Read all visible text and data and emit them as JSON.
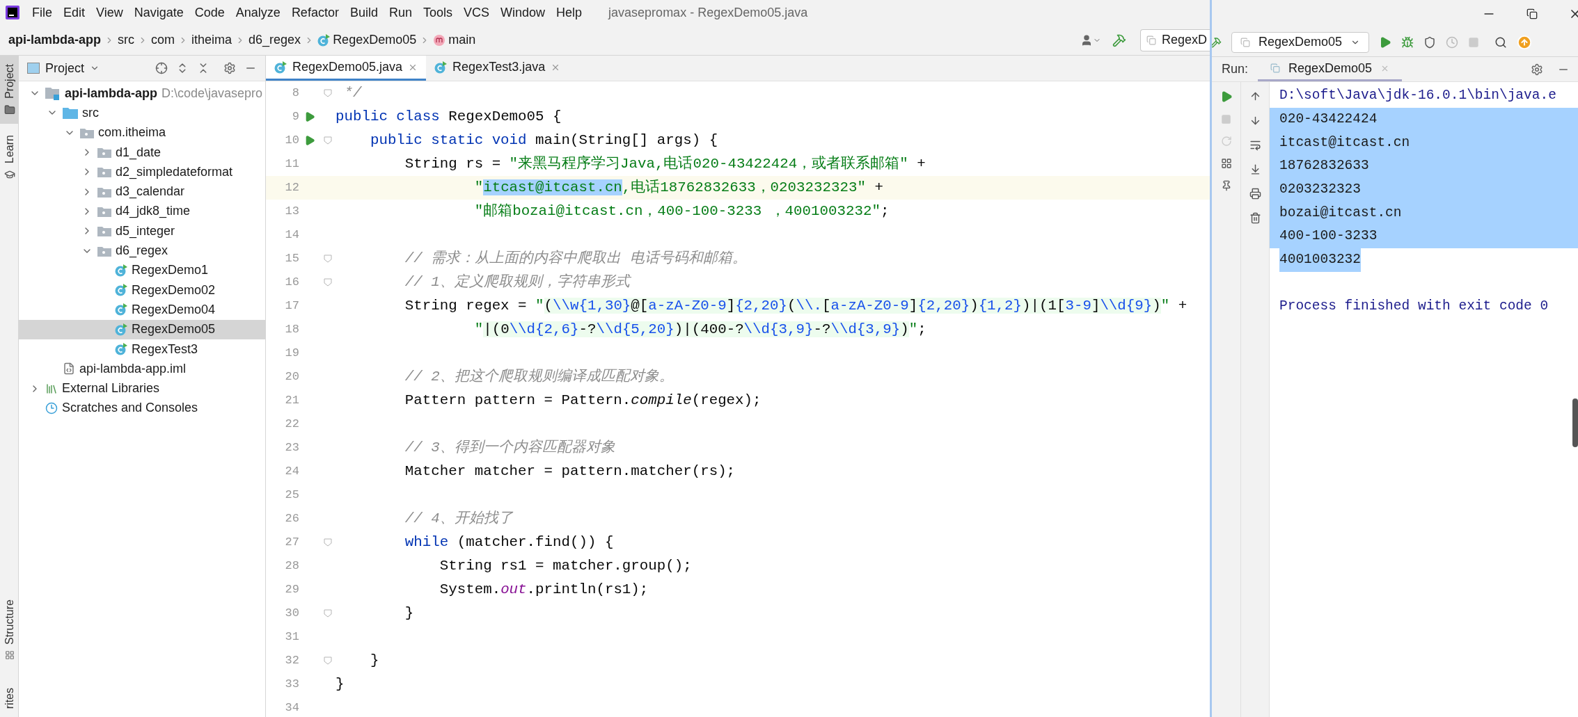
{
  "window": {
    "title": "javasepromax - RegexDemo05.java"
  },
  "menu": [
    "File",
    "Edit",
    "View",
    "Navigate",
    "Code",
    "Analyze",
    "Refactor",
    "Build",
    "Run",
    "Tools",
    "VCS",
    "Window",
    "Help"
  ],
  "breadcrumbs": [
    {
      "label": "api-lambda-app",
      "kind": "module"
    },
    {
      "label": "src",
      "kind": "folder"
    },
    {
      "label": "com",
      "kind": "folder"
    },
    {
      "label": "itheima",
      "kind": "folder"
    },
    {
      "label": "d6_regex",
      "kind": "folder"
    },
    {
      "label": "RegexDemo05",
      "kind": "class"
    },
    {
      "label": "main",
      "kind": "method"
    }
  ],
  "toolbar": {
    "cut_config": "RegexD",
    "run_config": "RegexDemo05"
  },
  "side_stripe": [
    {
      "label": "Project",
      "selected": true,
      "kind": "folder"
    },
    {
      "label": "Learn",
      "selected": false,
      "kind": "cap"
    }
  ],
  "side_stripe_bottom": [
    {
      "label": "Structure",
      "kind": "structure"
    },
    {
      "label": "rites",
      "kind": "none"
    }
  ],
  "project": {
    "title": "Project",
    "tree": [
      {
        "label": "api-lambda-app",
        "kind": "module",
        "hint": "D:\\code\\javasepro",
        "expanded": true,
        "selected": false,
        "children": [
          {
            "label": "src",
            "kind": "source",
            "expanded": true,
            "selected": false,
            "children": [
              {
                "label": "com.itheima",
                "kind": "package",
                "expanded": true,
                "selected": false,
                "children": [
                  {
                    "label": "d1_date",
                    "kind": "package",
                    "expanded": false,
                    "selected": false
                  },
                  {
                    "label": "d2_simpledateformat",
                    "kind": "package",
                    "expanded": false,
                    "selected": false
                  },
                  {
                    "label": "d3_calendar",
                    "kind": "package",
                    "expanded": false,
                    "selected": false
                  },
                  {
                    "label": "d4_jdk8_time",
                    "kind": "package",
                    "expanded": false,
                    "selected": false
                  },
                  {
                    "label": "d5_integer",
                    "kind": "package",
                    "expanded": false,
                    "selected": false
                  },
                  {
                    "label": "d6_regex",
                    "kind": "package",
                    "expanded": true,
                    "selected": false,
                    "children": [
                      {
                        "label": "RegexDemo1",
                        "kind": "class",
                        "selected": false
                      },
                      {
                        "label": "RegexDemo02",
                        "kind": "class",
                        "selected": false
                      },
                      {
                        "label": "RegexDemo04",
                        "kind": "class",
                        "selected": false
                      },
                      {
                        "label": "RegexDemo05",
                        "kind": "class",
                        "selected": true
                      },
                      {
                        "label": "RegexTest3",
                        "kind": "class",
                        "selected": false
                      }
                    ]
                  }
                ]
              }
            ]
          },
          {
            "label": "api-lambda-app.iml",
            "kind": "iml",
            "selected": false
          }
        ]
      },
      {
        "label": "External Libraries",
        "kind": "libraries",
        "expanded": false,
        "selected": false
      },
      {
        "label": "Scratches and Consoles",
        "kind": "scratches",
        "selected": false
      }
    ]
  },
  "editor_tabs": [
    {
      "label": "RegexDemo05.java",
      "selected": true
    },
    {
      "label": "RegexTest3.java",
      "selected": false
    }
  ],
  "lines": [
    {
      "number": "8",
      "run": false,
      "fold": true,
      "current": false,
      "tokens": [
        {
          "text": " */",
          "kind": "comment"
        }
      ]
    },
    {
      "number": "9",
      "run": true,
      "fold": false,
      "current": false,
      "tokens": [
        {
          "text": "public class",
          "kind": "keyword"
        },
        {
          "text": " RegexDemo05 {",
          "kind": "plain"
        }
      ]
    },
    {
      "number": "10",
      "run": true,
      "fold": true,
      "current": false,
      "tokens": [
        {
          "text": "    public static void",
          "kind": "keyword"
        },
        {
          "text": " main(String[] args) {",
          "kind": "plain"
        }
      ]
    },
    {
      "number": "11",
      "run": false,
      "fold": false,
      "current": false,
      "tokens": [
        {
          "text": "        String rs = ",
          "kind": "plain"
        },
        {
          "text": "\"来黑马程序学习Java,电话020-43422424，或者联系邮箱\"",
          "kind": "string"
        },
        {
          "text": " +",
          "kind": "plain"
        }
      ]
    },
    {
      "number": "12",
      "run": false,
      "fold": false,
      "current": true,
      "tokens": [
        {
          "text": "                \"",
          "kind": "string"
        },
        {
          "text": "itcast@itcast.cn",
          "kind": "selection"
        },
        {
          "text": ",电话18762832633，0203232323\"",
          "kind": "string"
        },
        {
          "text": " +",
          "kind": "plain"
        }
      ]
    },
    {
      "number": "13",
      "run": false,
      "fold": false,
      "current": false,
      "tokens": [
        {
          "text": "                \"邮箱bozai@itcast.cn，400-100-3233 ，4001003232\"",
          "kind": "string"
        },
        {
          "text": ";",
          "kind": "plain"
        }
      ]
    },
    {
      "number": "14",
      "run": false,
      "fold": false,
      "current": false
    },
    {
      "number": "15",
      "run": false,
      "fold": true,
      "current": false,
      "tokens": [
        {
          "text": "        // 需求：从上面的内容中爬取出 电话号码和邮箱。",
          "kind": "comment"
        }
      ]
    },
    {
      "number": "16",
      "run": false,
      "fold": true,
      "current": false,
      "tokens": [
        {
          "text": "        // 1、定义爬取规则，字符串形式",
          "kind": "comment"
        }
      ]
    },
    {
      "number": "17",
      "run": false,
      "fold": false,
      "current": false,
      "tokens": [
        {
          "text": "        String regex = ",
          "kind": "plain"
        },
        {
          "text": "\"",
          "kind": "string"
        },
        {
          "text": "(",
          "kind": "regex"
        },
        {
          "text": "\\\\w{1,30}",
          "kind": "regex_meta"
        },
        {
          "text": "@[",
          "kind": "regex"
        },
        {
          "text": "a-zA-Z0-9",
          "kind": "regex_meta"
        },
        {
          "text": "]",
          "kind": "regex"
        },
        {
          "text": "{2,20}",
          "kind": "regex_meta"
        },
        {
          "text": "(",
          "kind": "regex"
        },
        {
          "text": "\\\\.",
          "kind": "regex_meta"
        },
        {
          "text": "[",
          "kind": "regex"
        },
        {
          "text": "a-zA-Z0-9",
          "kind": "regex_meta"
        },
        {
          "text": "]",
          "kind": "regex"
        },
        {
          "text": "{2,20}",
          "kind": "regex_meta"
        },
        {
          "text": ")",
          "kind": "regex"
        },
        {
          "text": "{1,2}",
          "kind": "regex_meta"
        },
        {
          "text": ")|(1[",
          "kind": "regex"
        },
        {
          "text": "3-9",
          "kind": "regex_meta"
        },
        {
          "text": "]",
          "kind": "regex"
        },
        {
          "text": "\\\\d{9}",
          "kind": "regex_meta"
        },
        {
          "text": ")",
          "kind": "regex"
        },
        {
          "text": "\"",
          "kind": "string"
        },
        {
          "text": " +",
          "kind": "plain"
        }
      ]
    },
    {
      "number": "18",
      "run": false,
      "fold": false,
      "current": false,
      "tokens": [
        {
          "text": "                \"",
          "kind": "string"
        },
        {
          "text": "|(0",
          "kind": "regex"
        },
        {
          "text": "\\\\d{2,6}",
          "kind": "regex_meta"
        },
        {
          "text": "-?",
          "kind": "regex"
        },
        {
          "text": "\\\\d{5,20}",
          "kind": "regex_meta"
        },
        {
          "text": ")|(400-?",
          "kind": "regex"
        },
        {
          "text": "\\\\d{3,9}",
          "kind": "regex_meta"
        },
        {
          "text": "-?",
          "kind": "regex"
        },
        {
          "text": "\\\\d{3,9}",
          "kind": "regex_meta"
        },
        {
          "text": ")",
          "kind": "regex"
        },
        {
          "text": "\"",
          "kind": "string"
        },
        {
          "text": ";",
          "kind": "plain"
        }
      ]
    },
    {
      "number": "19",
      "run": false,
      "fold": false,
      "current": false
    },
    {
      "number": "20",
      "run": false,
      "fold": false,
      "current": false,
      "tokens": [
        {
          "text": "        // 2、把这个爬取规则编译成匹配对象。",
          "kind": "comment"
        }
      ]
    },
    {
      "number": "21",
      "run": false,
      "fold": false,
      "current": false,
      "tokens": [
        {
          "text": "        Pattern pattern = Pattern.",
          "kind": "plain"
        },
        {
          "text": "compile",
          "kind": "static"
        },
        {
          "text": "(regex);",
          "kind": "plain"
        }
      ]
    },
    {
      "number": "22",
      "run": false,
      "fold": false,
      "current": false
    },
    {
      "number": "23",
      "run": false,
      "fold": false,
      "current": false,
      "tokens": [
        {
          "text": "        // 3、得到一个内容匹配器对象",
          "kind": "comment"
        }
      ]
    },
    {
      "number": "24",
      "run": false,
      "fold": false,
      "current": false,
      "tokens": [
        {
          "text": "        Matcher matcher = pattern.matcher(rs);",
          "kind": "plain"
        }
      ]
    },
    {
      "number": "25",
      "run": false,
      "fold": false,
      "current": false
    },
    {
      "number": "26",
      "run": false,
      "fold": false,
      "current": false,
      "tokens": [
        {
          "text": "        // 4、开始找了",
          "kind": "comment"
        }
      ]
    },
    {
      "number": "27",
      "run": false,
      "fold": true,
      "current": false,
      "tokens": [
        {
          "text": "        while",
          "kind": "keyword"
        },
        {
          "text": " (matcher.find()) {",
          "kind": "plain"
        }
      ]
    },
    {
      "number": "28",
      "run": false,
      "fold": false,
      "current": false,
      "tokens": [
        {
          "text": "            String rs1 = matcher.group();",
          "kind": "plain"
        }
      ]
    },
    {
      "number": "29",
      "run": false,
      "fold": false,
      "current": false,
      "tokens": [
        {
          "text": "            System.",
          "kind": "plain"
        },
        {
          "text": "out",
          "kind": "field"
        },
        {
          "text": ".println(rs1);",
          "kind": "plain"
        }
      ]
    },
    {
      "number": "30",
      "run": false,
      "fold": true,
      "current": false,
      "tokens": [
        {
          "text": "        }",
          "kind": "plain"
        }
      ]
    },
    {
      "number": "31",
      "run": false,
      "fold": false,
      "current": false
    },
    {
      "number": "32",
      "run": false,
      "fold": true,
      "current": false,
      "tokens": [
        {
          "text": "    }",
          "kind": "plain"
        }
      ]
    },
    {
      "number": "33",
      "run": false,
      "fold": false,
      "current": false,
      "tokens": [
        {
          "text": "}",
          "kind": "plain"
        }
      ]
    },
    {
      "number": "34",
      "run": false,
      "fold": false,
      "current": false
    }
  ],
  "run_panel": {
    "label": "Run:",
    "tab": {
      "label": "RegexDemo05",
      "selected": true
    },
    "console": [
      {
        "text": "D:\\soft\\Java\\jdk-16.0.1\\bin\\java.e",
        "kind": "command",
        "selected": false
      },
      {
        "text": "020-43422424",
        "kind": "output",
        "selected": true
      },
      {
        "text": "itcast@itcast.cn",
        "kind": "output",
        "selected": true
      },
      {
        "text": "18762832633",
        "kind": "output",
        "selected": true
      },
      {
        "text": "0203232323",
        "kind": "output",
        "selected": true
      },
      {
        "text": "bozai@itcast.cn",
        "kind": "output",
        "selected": true
      },
      {
        "text": "400-100-3233",
        "kind": "output",
        "selected": true
      },
      {
        "text": "4001003232",
        "kind": "output",
        "selected": true
      },
      {
        "text": "Process finished with exit code 0",
        "kind": "exit",
        "selected": false
      }
    ]
  }
}
